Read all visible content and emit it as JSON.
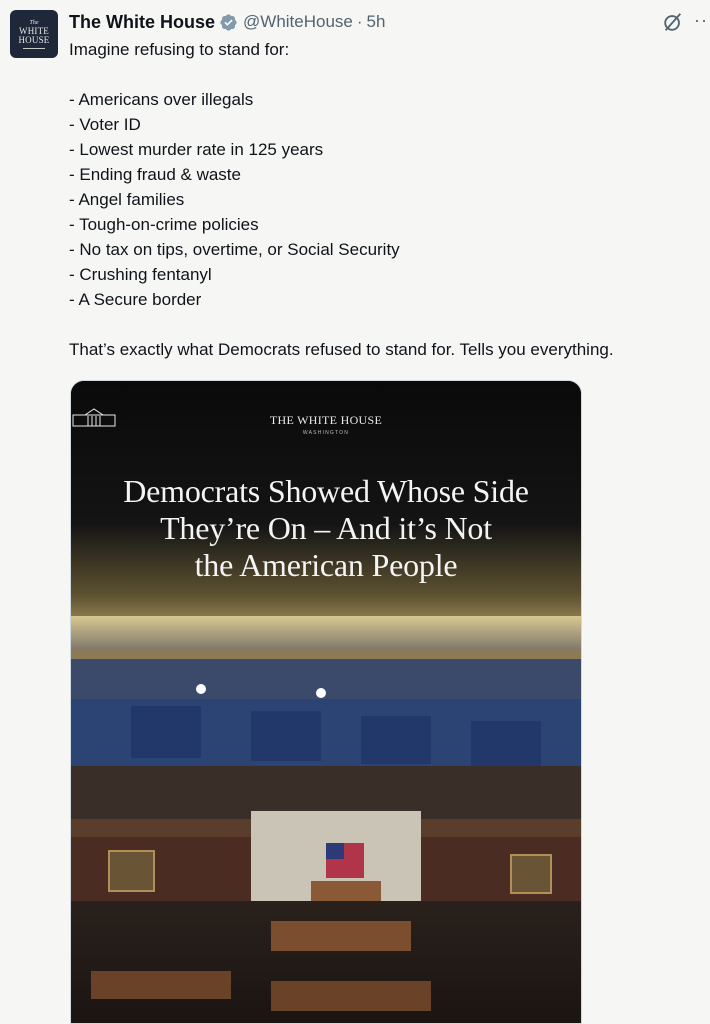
{
  "post": {
    "author_name": "The White House",
    "handle": "@WhiteHouse",
    "separator": "·",
    "time": "5h",
    "avatar_line1": "The",
    "avatar_line2": "WHITE",
    "avatar_line3": "HOUSE",
    "more_label": "··",
    "text_intro": "Imagine refusing to stand for:",
    "text_items": [
      "- Americans over illegals",
      "- Voter ID",
      "- Lowest murder rate in 125 years",
      "- Ending fraud & waste",
      "- Angel families",
      "- Tough-on-crime policies",
      "- No tax on tips, overtime, or Social Security",
      "- Crushing fentanyl",
      "- A Secure border"
    ],
    "text_outro": "That’s exactly what Democrats refused to stand for. Tells you everything."
  },
  "media": {
    "brand": "THE WHITE HOUSE",
    "brand_sub": "WASHINGTON",
    "headline_line1": "Democrats Showed Whose Side",
    "headline_line2": "They’re On – And it’s Not",
    "headline_line3": "the American People"
  },
  "icons": {
    "verified": "verified-badge-icon",
    "grok": "grok-icon",
    "more": "more-icon"
  },
  "colors": {
    "background": "#f6f6f5",
    "text": "#0f1419",
    "secondary": "#536471",
    "verified": "#829aab"
  }
}
